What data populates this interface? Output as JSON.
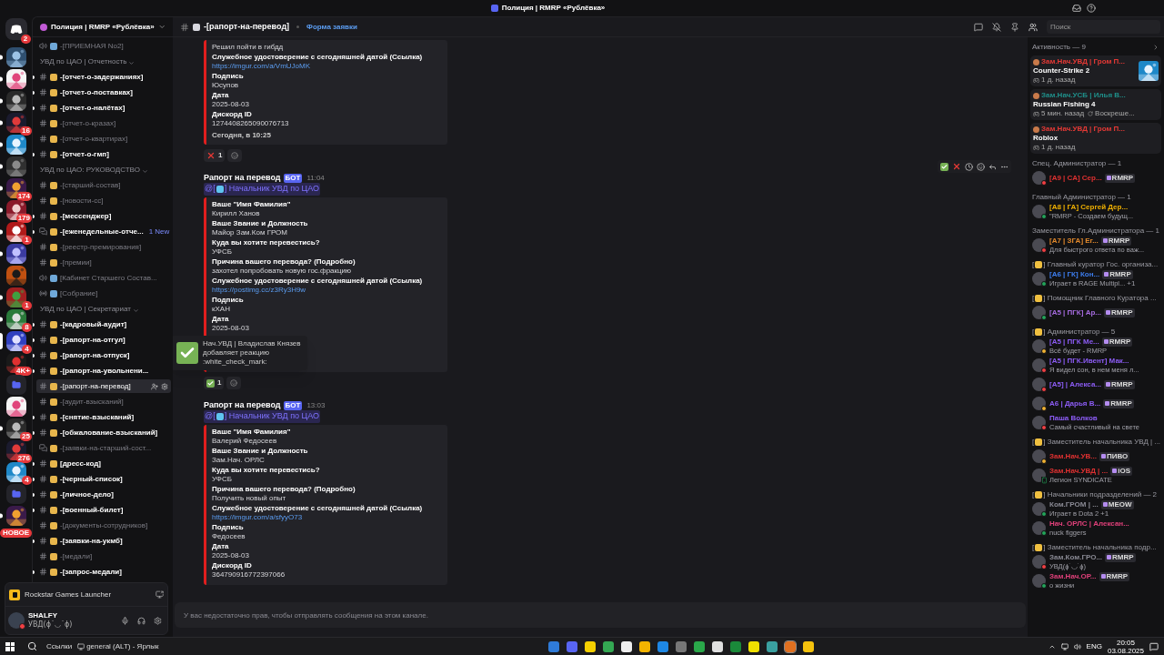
{
  "window": {
    "title": "Полиция | RMRP «Рублёвка»"
  },
  "server_rail": {
    "home_badge": "2",
    "new_label": "НОВОЕ",
    "servers": [
      {
        "kind": "server",
        "unread": true,
        "selected": false
      },
      {
        "kind": "server",
        "unread": true,
        "selected": false
      },
      {
        "kind": "server",
        "unread": true,
        "selected": false
      },
      {
        "kind": "server",
        "badge": "16",
        "unread": true,
        "selected": false
      },
      {
        "kind": "server",
        "unread": true,
        "selected": false
      },
      {
        "kind": "server",
        "unread": true,
        "selected": false
      },
      {
        "kind": "server",
        "badge": "174",
        "unread": true,
        "selected": false
      },
      {
        "kind": "server",
        "badge": "179",
        "unread": true,
        "selected": false
      },
      {
        "kind": "server",
        "badge": "1",
        "unread": true,
        "selected": false
      },
      {
        "kind": "server",
        "unread": true,
        "selected": false
      },
      {
        "kind": "server",
        "unread": false,
        "selected": false
      },
      {
        "kind": "server",
        "badge": "1",
        "unread": true,
        "selected": false
      },
      {
        "kind": "server",
        "badge": "8",
        "unread": true,
        "selected": false
      },
      {
        "kind": "server",
        "badge": "4",
        "unread": false,
        "selected": true
      },
      {
        "kind": "server",
        "badge": "4K+",
        "unread": false,
        "selected": false
      },
      {
        "kind": "folder",
        "unread": false,
        "selected": false
      },
      {
        "kind": "server",
        "unread": false,
        "selected": false
      },
      {
        "kind": "server",
        "badge": "25",
        "unread": true,
        "selected": false
      },
      {
        "kind": "server",
        "badge": "276",
        "unread": false,
        "selected": false
      },
      {
        "kind": "server",
        "badge": "4",
        "unread": false,
        "selected": false
      },
      {
        "kind": "folder",
        "unread": false,
        "selected": false
      },
      {
        "kind": "server",
        "unread": true,
        "selected": false
      }
    ]
  },
  "sidebar": {
    "server_name": "Полиция | RMRP «Рублёвка»",
    "groups": [
      {
        "kind": "loose",
        "channels": [
          {
            "kind": "voice",
            "name": "-[ПРИЕМНАЯ No2]",
            "unread": false,
            "selected": false
          }
        ]
      },
      {
        "kind": "category",
        "title": "УВД по ЦАО | Отчетность",
        "channels": [
          {
            "kind": "text",
            "name": "-[отчет-о-задержаниях]",
            "unread": true,
            "selected": false
          },
          {
            "kind": "text",
            "name": "-[отчет-о-поставках]",
            "unread": true,
            "selected": false
          },
          {
            "kind": "text",
            "name": "-[отчет-о-налётах]",
            "unread": true,
            "selected": false
          },
          {
            "kind": "text",
            "name": "-[отчет-о-кразах]",
            "unread": false,
            "selected": false
          },
          {
            "kind": "text",
            "name": "-[отчет-о-квартирах]",
            "unread": false,
            "selected": false
          },
          {
            "kind": "text",
            "name": "-[отчет-о-гмп]",
            "unread": true,
            "selected": false
          }
        ]
      },
      {
        "kind": "category",
        "title": "УВД по ЦАО: РУКОВОДСТВО",
        "channels": [
          {
            "kind": "text",
            "name": "-[старший-состав]",
            "unread": false,
            "selected": false
          },
          {
            "kind": "text",
            "name": "-[новости-сс]",
            "unread": false,
            "selected": false
          },
          {
            "kind": "text",
            "name": "-[мессенджер]",
            "unread": true,
            "selected": false
          },
          {
            "kind": "forum",
            "name": "-[еженедельные-отче...",
            "unread": true,
            "selected": false,
            "badge": "1 New"
          },
          {
            "kind": "text",
            "name": "-[реестр-премирования]",
            "unread": false,
            "selected": false
          },
          {
            "kind": "text",
            "name": "-[премии]",
            "unread": false,
            "selected": false
          },
          {
            "kind": "voice",
            "name": "[Кабинет Старшего Состав...",
            "unread": false,
            "selected": false
          },
          {
            "kind": "stage",
            "name": "[Собрание]",
            "unread": false,
            "selected": false
          }
        ]
      },
      {
        "kind": "category",
        "title": "УВД по ЦАО | Секретариат",
        "channels": [
          {
            "kind": "text",
            "name": "-[кадровый-аудит]",
            "unread": true,
            "selected": false
          },
          {
            "kind": "text",
            "name": "-[рапорт-на-отгул]",
            "unread": true,
            "selected": false
          },
          {
            "kind": "text",
            "name": "-[рапорт-на-отпуск]",
            "unread": true,
            "selected": false
          },
          {
            "kind": "text",
            "name": "-[рапорт-на-увольнени...",
            "unread": true,
            "selected": false
          },
          {
            "kind": "text",
            "name": "-[рапорт-на-перевод]",
            "unread": false,
            "selected": true
          },
          {
            "kind": "text",
            "name": "-[аудит-взысканий]",
            "unread": false,
            "selected": false
          },
          {
            "kind": "text",
            "name": "-[снятие-взысканий]",
            "unread": true,
            "selected": false
          },
          {
            "kind": "text",
            "name": "-[обжалование-взысканий]",
            "unread": true,
            "selected": false
          },
          {
            "kind": "forum",
            "name": "-[заявки-на-старший-сост...",
            "unread": false,
            "selected": false
          },
          {
            "kind": "text",
            "name": "[дресс-код]",
            "unread": true,
            "selected": false
          },
          {
            "kind": "text",
            "name": "-[черный-список]",
            "unread": true,
            "selected": false
          },
          {
            "kind": "text",
            "name": "-[личное-дело]",
            "unread": true,
            "selected": false
          },
          {
            "kind": "text",
            "name": "-[военный-билет]",
            "unread": true,
            "selected": false
          },
          {
            "kind": "text",
            "name": "-[документы-сотрудников]",
            "unread": false,
            "selected": false
          },
          {
            "kind": "text",
            "name": "-[заявки-на-укмб]",
            "unread": true,
            "selected": false
          },
          {
            "kind": "text",
            "name": "-[медали]",
            "unread": false,
            "selected": false
          },
          {
            "kind": "text",
            "name": "-[запрос-медали]",
            "unread": true,
            "selected": false
          }
        ]
      }
    ]
  },
  "user_panel": {
    "activity": "Rockstar Games Launcher",
    "username": "SHALFY",
    "status_text": "УВД(ɸ˙◡˙ɸ)"
  },
  "channel": {
    "name": "-[рапорт-на-перевод]",
    "link": "Форма заявки"
  },
  "search": {
    "placeholder": "Поиск"
  },
  "messages": [
    {
      "embed": {
        "fields": [
          {
            "value": "Решил пойти в гибдд"
          },
          {
            "label": "Служебное удостоверение с сегодняшней датой  (Ссылка)",
            "value": "https://imgur.com/a/VmUJoMK",
            "link": true
          },
          {
            "label": "Подпись",
            "value": "Юсупов"
          },
          {
            "label": "Дата",
            "value": "2025-08-03"
          },
          {
            "label": "Дискорд ID",
            "value": "1274408265090076713"
          }
        ],
        "footer": "Сегодня, в 10:25"
      },
      "reactions": [
        {
          "kind": "cross",
          "count": "1"
        }
      ]
    },
    {
      "author": "Рапорт на перевод",
      "tag": "БОТ",
      "time": "11:04",
      "mention": [
        "@[",
        "] Начальник УВД по ЦАО"
      ],
      "embed": {
        "fields": [
          {
            "label": "Ваше \"Имя Фамилия\"",
            "value": "Кирилл Ханов"
          },
          {
            "label": "Ваше  Звание и Должность",
            "value": "Майор Зам.Ком ГРОМ"
          },
          {
            "label": "Куда вы хотите перевестись?",
            "value": "УФСБ"
          },
          {
            "label": "Причина вашего перевода? (Подробно)",
            "value": "захотел попробовать новую гос.фракцию"
          },
          {
            "label": "Служебное удостоверение с сегодняшней датой  (Ссылка)",
            "value": "https://postimg.cc/z3Ry3H9w",
            "link": true
          },
          {
            "label": "Подпись",
            "value": "кХАН"
          },
          {
            "label": "Дата",
            "value": "2025-08-03"
          }
        ]
      },
      "reaction_toast": {
        "lines": [
          "Нач.УВД | Владислав Князев",
          "добавляет реакцию",
          ":white_check_mark:"
        ]
      },
      "reactions": [
        {
          "kind": "check",
          "count": "1"
        }
      ]
    },
    {
      "author": "Рапорт на перевод",
      "tag": "БОТ",
      "time": "13:03",
      "mention": [
        "@[",
        "] Начальник УВД по ЦАО"
      ],
      "embed": {
        "fields": [
          {
            "label": "Ваше \"Имя Фамилия\"",
            "value": "Валерий Федосеев"
          },
          {
            "label": "Ваше  Звание и Должность",
            "value": "Зам.Нач. ОРЛС"
          },
          {
            "label": "Куда вы хотите перевестись?",
            "value": "УФСБ"
          },
          {
            "label": "Причина вашего перевода? (Подробно)",
            "value": "Получить новый опыт"
          },
          {
            "label": "Служебное удостоверение с сегодняшней датой  (Ссылка)",
            "value": "https://imgur.com/a/sfyyO73",
            "link": true
          },
          {
            "label": "Подпись",
            "value": "Федосеев"
          },
          {
            "label": "Дата",
            "value": "2025-08-03"
          },
          {
            "label": "Дискорд ID",
            "value": "364790916772397066"
          }
        ]
      }
    }
  ],
  "composer": {
    "placeholder": "У вас недостаточно прав, чтобы отправлять сообщения на этом канале."
  },
  "members": {
    "activity": {
      "title": "Активность — 9",
      "cards": [
        {
          "name": "Зам.Нач.УВД | Гром П...",
          "color": "#e53935",
          "game": "Counter-Strike 2",
          "time": "1 д. назад",
          "kind": "picture"
        },
        {
          "name": "Зам.Нач.УСБ | Илья В...",
          "color": "#1f8f8a",
          "game": "Russian Fishing 4",
          "time": "5 мин. назад",
          "extra": "Воскреше..."
        },
        {
          "name": "Зам.Нач.УВД | Гром П...",
          "color": "#e53935",
          "game": "Roblox",
          "time": "1 д. назад"
        }
      ]
    },
    "groups": [
      {
        "title": [
          "Спец. Администратор — 1"
        ],
        "members": [
          {
            "name": "[А9 | СА] Сер...",
            "color": "#e03131",
            "kind": "dnd",
            "badge": "RMRP"
          }
        ]
      },
      {
        "title": [
          "Главный Администратор — 1"
        ],
        "members": [
          {
            "name": "[А8 | ГА] Сергей Дер...",
            "color": "#f1b100",
            "kind": "online",
            "sub": "\"RMRP - Создаем будущ..."
          }
        ]
      },
      {
        "title": [
          "Заместитель Гл.Администратора — 1"
        ],
        "members": [
          {
            "name": "[А7 | ЗГА] Ег...",
            "color": "#e38a2c",
            "kind": "dnd",
            "badge": "RMRP",
            "sub": "Для быстрого ответа по важ..."
          }
        ]
      },
      {
        "title": [
          "[",
          "] Главный куратор Гос. организа..."
        ],
        "members": [
          {
            "name": "[А6 | ГК] Кон...",
            "color": "#3d7ef0",
            "kind": "online",
            "badge": "RMRP",
            "sub": "Играет в RAGE Multipl...",
            "sub_extra": "+1"
          }
        ]
      },
      {
        "title": [
          "[",
          "] Помощник Главного Куратора ..."
        ],
        "members": [
          {
            "name": "[А5 | ПГК] Ар...",
            "color": "#a66be0",
            "kind": "online",
            "badge": "RMRP"
          }
        ]
      },
      {
        "title": [
          "[",
          "] Администратор — 5"
        ],
        "members": [
          {
            "name": "[А5 | ПГК Ме...",
            "color": "#8c5cf5",
            "kind": "idle",
            "badge": "RMRP",
            "sub": "Всё будет - RMRP"
          },
          {
            "name": "[А5 | ПГК.Ивент] Мак...",
            "color": "#8c5cf5",
            "kind": "dnd",
            "sub": "Я видел сон, в нем меня л..."
          },
          {
            "name": "[А5] | Алекса...",
            "color": "#8c5cf5",
            "kind": "dnd",
            "badge": "RMRP"
          },
          {
            "name": "А6 | Дарья В...",
            "color": "#8c5cf5",
            "kind": "idle",
            "badge": "RMRP"
          },
          {
            "name": "Паша Волков",
            "color": "#8c5cf5",
            "kind": "dnd",
            "sub": "Самый счастливый на свете"
          }
        ]
      },
      {
        "title": [
          "[",
          "] Заместитель начальника УВД | ..."
        ],
        "members": [
          {
            "name": "Зам.Нач.УВ...",
            "color": "#e03131",
            "kind": "idle",
            "badge": "ПИВО"
          },
          {
            "name": "Зам.Нач.УВД | ...",
            "color": "#e03131",
            "kind": "mobile",
            "badge": "iOS",
            "sub": "Легион SYNDICATE"
          }
        ]
      },
      {
        "title": [
          "[",
          "] Начальники подразделений — 2"
        ],
        "members": [
          {
            "name": "Ком.ГРОМ | ...",
            "color": "#8a8a94",
            "kind": "online",
            "badge": "MEOW",
            "sub": "Играет в Dota 2",
            "sub_extra": "+1"
          },
          {
            "name": "Нач. ОРЛС | Алексан...",
            "color": "#e0407a",
            "kind": "online",
            "sub": "nuck figgers"
          }
        ]
      },
      {
        "title": [
          "[",
          "] Заместитель начальника подр..."
        ],
        "members": [
          {
            "name": "Зам.Ком.ГРО...",
            "color": "#8a8a94",
            "kind": "dnd",
            "badge": "RMRP",
            "sub": "УВД(ɸ˙◡˙ɸ)"
          },
          {
            "name": "Зам.Нач.ОР...",
            "color": "#e0407a",
            "kind": "online",
            "badge": "RMRP",
            "sub": "о жизни"
          }
        ]
      }
    ]
  },
  "taskbar": {
    "links_label": "Ссылки",
    "shortcut": "general (ALT) - Ярлык",
    "language": "ENG",
    "time": "20:05",
    "date": "03.08.2025"
  }
}
